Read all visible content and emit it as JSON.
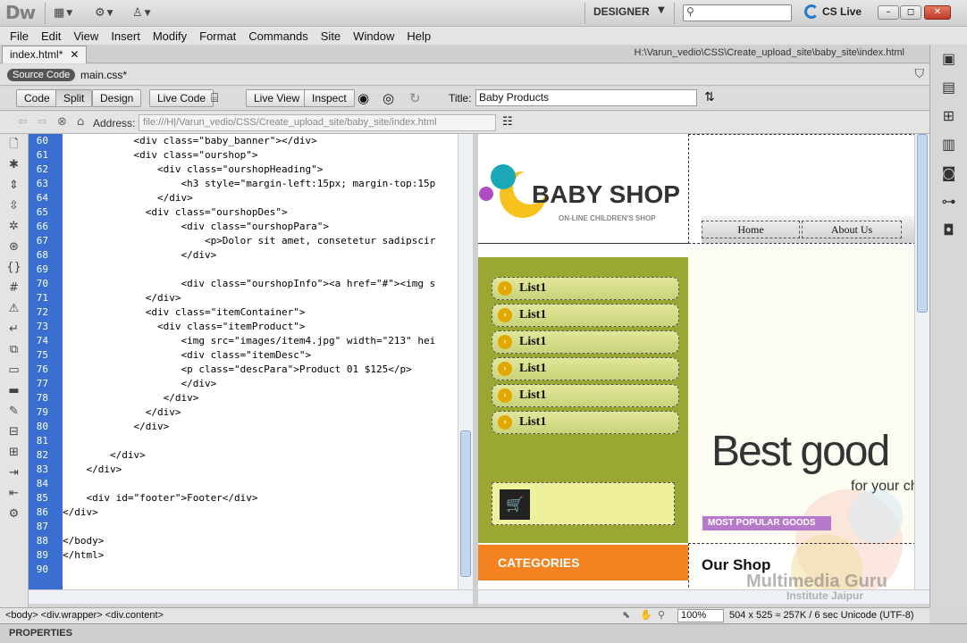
{
  "app": {
    "logo": "Dw",
    "workspace": "DESIGNER",
    "cs_live": "CS Live"
  },
  "menu": [
    "File",
    "Edit",
    "View",
    "Insert",
    "Modify",
    "Format",
    "Commands",
    "Site",
    "Window",
    "Help"
  ],
  "document": {
    "tab": "index.html*",
    "path": "H:\\Varun_vedio\\CSS\\Create_upload_site\\baby_site\\index.html",
    "source_code": "Source Code",
    "related_file": "main.css*"
  },
  "doc_toolbar": {
    "code": "Code",
    "split": "Split",
    "design": "Design",
    "live_code": "Live Code",
    "live_view": "Live View",
    "inspect": "Inspect",
    "title_label": "Title:",
    "title_value": "Baby Products"
  },
  "address": {
    "label": "Address:",
    "value": "file:///H|/Varun_vedio/CSS/Create_upload_site/baby_site/index.html"
  },
  "code_lines": [
    {
      "n": "60",
      "t": "            <div class=\"baby_banner\"></div>"
    },
    {
      "n": "61",
      "t": "            <div class=\"ourshop\">"
    },
    {
      "n": "62",
      "t": "                <div class=\"ourshopHeading\">"
    },
    {
      "n": "63",
      "t": "                    <h3 style=\"margin-left:15px; margin-top:15p"
    },
    {
      "n": "64",
      "t": "                </div>"
    },
    {
      "n": "65",
      "t": "              <div class=\"ourshopDes\">"
    },
    {
      "n": "66",
      "t": "                    <div class=\"ourshopPara\">"
    },
    {
      "n": "67",
      "t": "                        <p>Dolor sit amet, consetetur sadipscir"
    },
    {
      "n": "68",
      "t": "                    </div>"
    },
    {
      "n": "69",
      "t": ""
    },
    {
      "n": "70",
      "t": "                    <div class=\"ourshopInfo\"><a href=\"#\"><img s"
    },
    {
      "n": "71",
      "t": "              </div>"
    },
    {
      "n": "72",
      "t": "              <div class=\"itemContainer\">"
    },
    {
      "n": "73",
      "t": "                <div class=\"itemProduct\">"
    },
    {
      "n": "74",
      "t": "                    <img src=\"images/item4.jpg\" width=\"213\" hei"
    },
    {
      "n": "75",
      "t": "                    <div class=\"itemDesc\">"
    },
    {
      "n": "76",
      "t": "                    <p class=\"descPara\">Product 01 $125</p>"
    },
    {
      "n": "77",
      "t": "                    </div>"
    },
    {
      "n": "78",
      "t": "                 </div>"
    },
    {
      "n": "79",
      "t": "              </div>"
    },
    {
      "n": "80",
      "t": "            </div>"
    },
    {
      "n": "81",
      "t": ""
    },
    {
      "n": "82",
      "t": "        </div>"
    },
    {
      "n": "83",
      "t": "    </div>"
    },
    {
      "n": "84",
      "t": ""
    },
    {
      "n": "85",
      "t": "    <div id=\"footer\">Footer</div>"
    },
    {
      "n": "86",
      "t": "</div>"
    },
    {
      "n": "87",
      "t": ""
    },
    {
      "n": "88",
      "t": "</body>"
    },
    {
      "n": "89",
      "t": "</html>"
    },
    {
      "n": "90",
      "t": ""
    }
  ],
  "design_view": {
    "logo_title": "BABY SHOP",
    "logo_subtitle": "ON-LINE CHILDREN'S SHOP",
    "nav": [
      "Home",
      "About Us"
    ],
    "list_items": [
      "List1",
      "List1",
      "List1",
      "List1",
      "List1",
      "List1"
    ],
    "categories": "CATEGORIES",
    "banner_headline": "Best good",
    "banner_sub": "for your ch",
    "popular": "MOST POPULAR GOODS",
    "our_shop": "Our Shop"
  },
  "status": {
    "tag_selector": "<body> <div.wrapper> <div.content>",
    "zoom": "100%",
    "dimensions": "504 x 525 ≈ 257K / 6 sec  Unicode (UTF-8)"
  },
  "properties_label": "PROPERTIES",
  "watermark": {
    "line1": "Multimedia Guru",
    "line2": "Institute Jaipur"
  },
  "colors": {
    "gutter": "#3a6fd1",
    "sidebar_green": "#9aa733",
    "categories_orange": "#f58220",
    "popular_purple": "#b77acb"
  }
}
